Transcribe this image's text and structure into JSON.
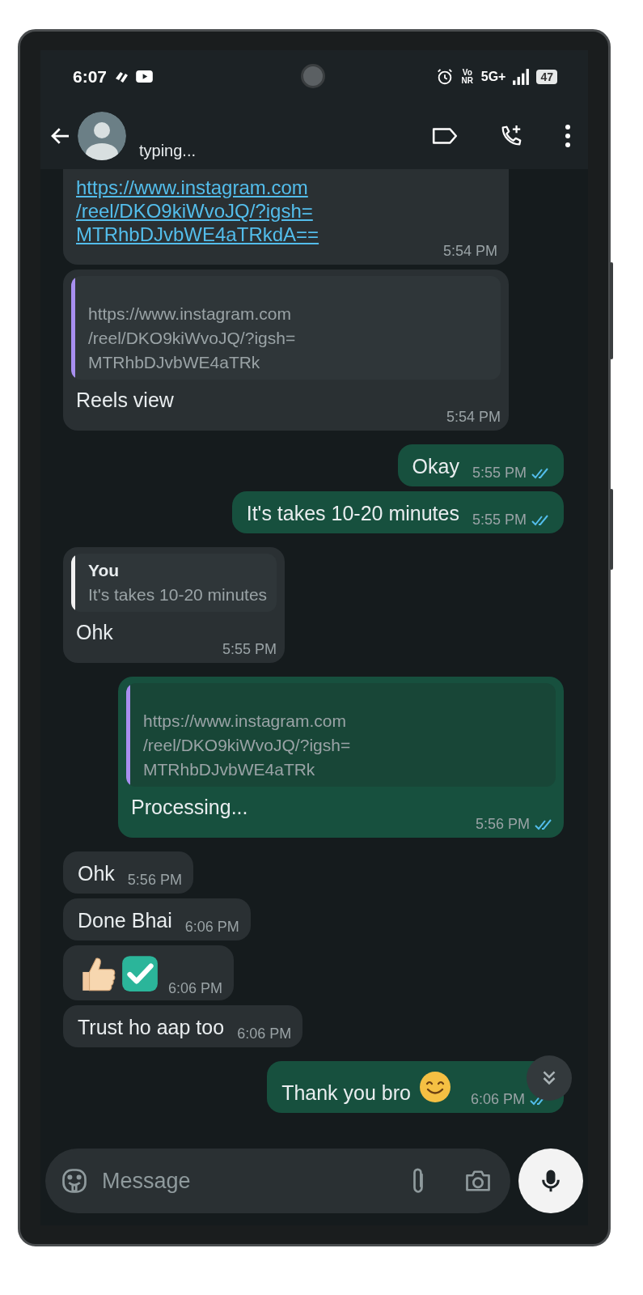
{
  "status_bar": {
    "time": "6:07",
    "volte": "Vo NR",
    "network": "5G+",
    "battery": "47"
  },
  "header": {
    "status": "typing..."
  },
  "messages": [
    {
      "kind": "link",
      "outgoing": false,
      "lines": [
        "https://www.instagram.com",
        "/reel/DKO9kiWvoJQ/?igsh=",
        "MTRhbDJvbWE4aTRkdA=="
      ],
      "time": "5:54 PM"
    },
    {
      "kind": "preview",
      "outgoing": false,
      "lines": [
        "https://www.instagram.com",
        "/reel/DKO9kiWvoJQ/?igsh=",
        "MTRhbDJvbWE4aTRk"
      ],
      "text": "Reels view",
      "time": "5:54 PM"
    },
    {
      "kind": "text",
      "outgoing": true,
      "text": "Okay",
      "time": "5:55 PM",
      "read": true
    },
    {
      "kind": "text",
      "outgoing": true,
      "text": "It's takes 10-20 minutes",
      "time": "5:55 PM",
      "read": true
    },
    {
      "kind": "reply",
      "outgoing": false,
      "quote_author": "You",
      "quote_text": "It's takes 10-20 minutes",
      "text": "Ohk",
      "time": "5:55 PM"
    },
    {
      "kind": "preview",
      "outgoing": true,
      "lines": [
        "https://www.instagram.com",
        "/reel/DKO9kiWvoJQ/?igsh=",
        "MTRhbDJvbWE4aTRk"
      ],
      "text": "Processing...",
      "time": "5:56 PM",
      "read": true
    },
    {
      "kind": "text",
      "outgoing": false,
      "text": "Ohk",
      "time": "5:56 PM"
    },
    {
      "kind": "text",
      "outgoing": false,
      "text": "Done Bhai",
      "time": "6:06 PM"
    },
    {
      "kind": "stickers",
      "outgoing": false,
      "time": "6:06 PM"
    },
    {
      "kind": "text",
      "outgoing": false,
      "text": "Trust ho aap too",
      "time": "6:06 PM"
    },
    {
      "kind": "text_smile",
      "outgoing": true,
      "text": "Thank you bro",
      "time": "6:06 PM",
      "read": true
    }
  ],
  "composer": {
    "placeholder": "Message"
  }
}
